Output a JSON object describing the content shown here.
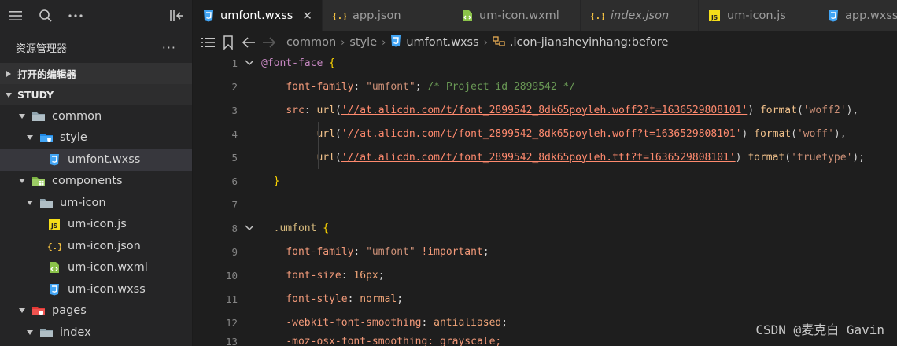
{
  "sidebar": {
    "title": "资源管理器",
    "more": "···",
    "open_editors": "打开的编辑器",
    "workspace": "STUDY",
    "tree": [
      {
        "label": "common",
        "depth": 1,
        "type": "folder",
        "open": true
      },
      {
        "label": "style",
        "depth": 2,
        "type": "folder-blue",
        "open": true
      },
      {
        "label": "umfont.wxss",
        "depth": 3,
        "type": "wxss",
        "selected": true
      },
      {
        "label": "components",
        "depth": 1,
        "type": "folder-green",
        "open": true
      },
      {
        "label": "um-icon",
        "depth": 2,
        "type": "folder",
        "open": true
      },
      {
        "label": "um-icon.js",
        "depth": 3,
        "type": "js"
      },
      {
        "label": "um-icon.json",
        "depth": 3,
        "type": "json"
      },
      {
        "label": "um-icon.wxml",
        "depth": 3,
        "type": "wxml"
      },
      {
        "label": "um-icon.wxss",
        "depth": 3,
        "type": "wxss"
      },
      {
        "label": "pages",
        "depth": 1,
        "type": "folder-red",
        "open": true
      },
      {
        "label": "index",
        "depth": 2,
        "type": "folder",
        "open": true
      }
    ]
  },
  "tabs": [
    {
      "label": "umfont.wxss",
      "type": "wxss",
      "active": true,
      "italic": false,
      "close": "✕"
    },
    {
      "label": "app.json",
      "type": "json",
      "active": false,
      "italic": false
    },
    {
      "label": "um-icon.wxml",
      "type": "wxml",
      "active": false,
      "italic": false
    },
    {
      "label": "index.json",
      "type": "json",
      "active": false,
      "italic": true
    },
    {
      "label": "um-icon.js",
      "type": "js",
      "active": false,
      "italic": false
    },
    {
      "label": "app.wxss",
      "type": "wxss",
      "active": false,
      "italic": false
    }
  ],
  "breadcrumb": {
    "segments": [
      "common",
      "style",
      "umfont.wxss",
      ".icon-jiansheyinhang:before"
    ]
  },
  "code": {
    "line_numbers": [
      "1",
      "2",
      "3",
      "4",
      "5",
      "6",
      "7",
      "8",
      "9",
      "10",
      "11",
      "12",
      "13"
    ],
    "l1_sel": "@font-face",
    "l1_brace": "{",
    "l2_prop": "font-family",
    "l2_val": "\"umfont\"",
    "l2_comment": "/* Project id 2899542 */",
    "l3_prop": "src",
    "url1": "'//at.alicdn.com/t/font_2899542_8dk65poyleh.woff2?t=1636529808101'",
    "fmt1": "'woff2'",
    "url2": "'//at.alicdn.com/t/font_2899542_8dk65poyleh.woff?t=1636529808101'",
    "fmt2": "'woff'",
    "url3": "'//at.alicdn.com/t/font_2899542_8dk65poyleh.ttf?t=1636529808101'",
    "fmt3": "'truetype'",
    "fn_url": "url",
    "fn_format": "format",
    "l6_brace": "}",
    "l8_sel": ".umfont",
    "l8_brace": "{",
    "l9_prop": "font-family",
    "l9_val": "\"umfont\"",
    "l9_imp": "!important",
    "l10_prop": "font-size",
    "l10_val": "16px",
    "l11_prop": "font-style",
    "l11_val": "normal",
    "l12_prop": "-webkit-font-smoothing",
    "l12_val": "antialiased",
    "l13_partial": "-moz-osx-font-smoothing: grayscale;"
  },
  "watermark": "CSDN @麦克白_Gavin",
  "colors": {
    "accent_js": "#f5de19",
    "accent_css": "#42a5f5",
    "accent_wxml": "#8bc34a",
    "accent_json": "#f5c242"
  }
}
